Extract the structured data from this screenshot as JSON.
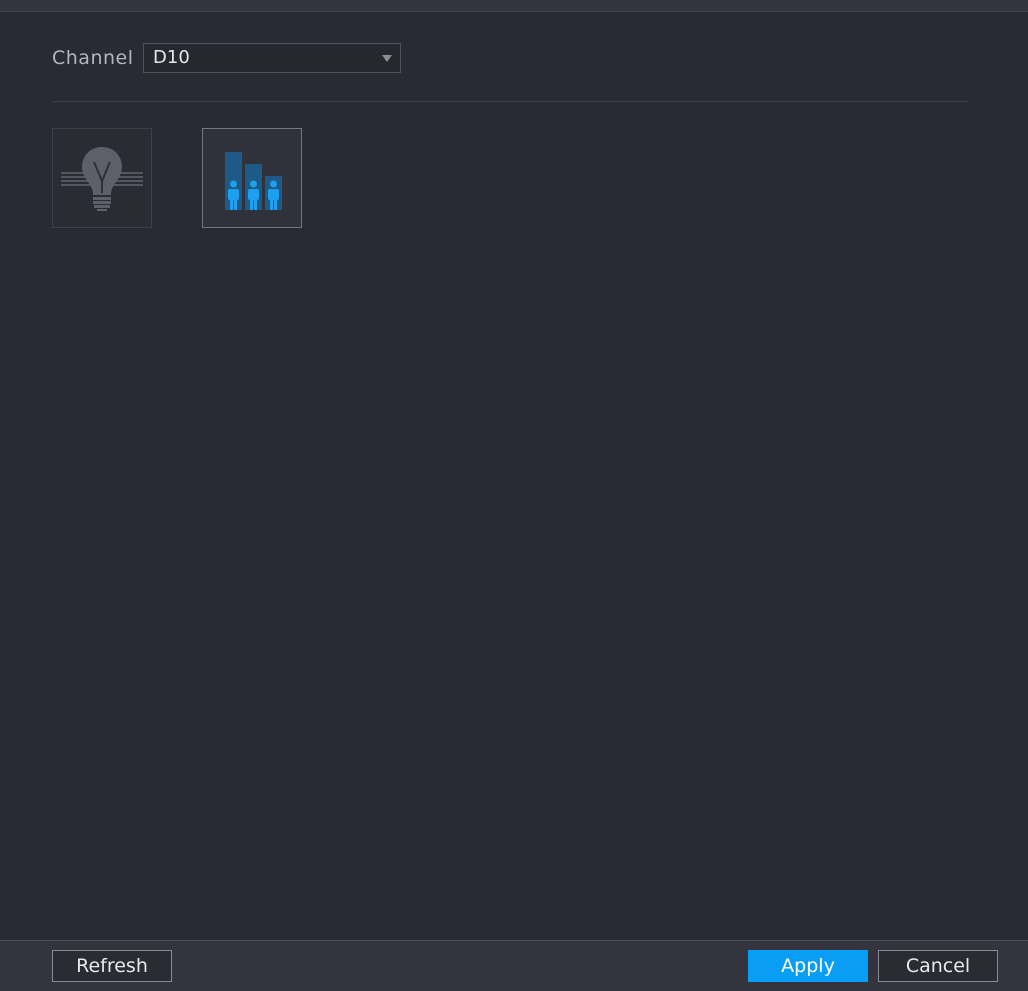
{
  "channel": {
    "label": "Channel",
    "selected": "D10"
  },
  "tiles": [
    {
      "icon": "lightbulb-icon",
      "state": "disabled"
    },
    {
      "icon": "people-counting-icon",
      "state": "enabled"
    }
  ],
  "footer": {
    "refresh_label": "Refresh",
    "apply_label": "Apply",
    "cancel_label": "Cancel"
  },
  "colors": {
    "background": "#292a33",
    "accent": "#0a9df5",
    "icon_blue": "#1ea0f0"
  }
}
